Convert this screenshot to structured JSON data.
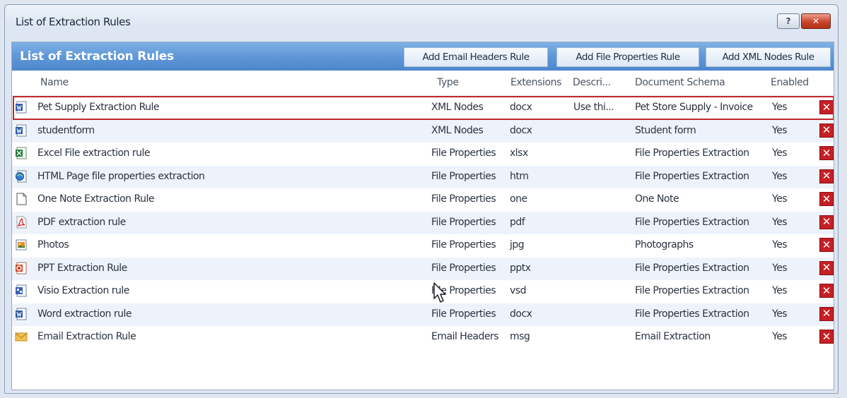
{
  "window": {
    "title": "List of Extraction Rules",
    "help_glyph": "?",
    "close_glyph": "✕"
  },
  "panel": {
    "title": "List of Extraction Rules",
    "buttons": [
      "Add Email Headers Rule",
      "Add File Properties Rule",
      "Add XML Nodes Rule"
    ]
  },
  "columns": [
    "Name",
    "Type",
    "Extensions",
    "Descri...",
    "Document Schema",
    "Enabled"
  ],
  "rows": [
    {
      "icon": "word-doc-icon",
      "name": "Pet Supply Extraction Rule",
      "type": "XML Nodes",
      "ext": "docx",
      "desc": "Use thi...",
      "schema": "Pet Store Supply - Invoice",
      "enabled": "Yes",
      "selected": true
    },
    {
      "icon": "word-doc-icon",
      "name": "studentform",
      "type": "XML Nodes",
      "ext": "docx",
      "desc": "",
      "schema": "Student form",
      "enabled": "Yes"
    },
    {
      "icon": "excel-icon",
      "name": "Excel File extraction rule",
      "type": "File Properties",
      "ext": "xlsx",
      "desc": "",
      "schema": "File Properties Extraction",
      "enabled": "Yes"
    },
    {
      "icon": "html-page-icon",
      "name": "HTML Page file properties extraction",
      "type": "File Properties",
      "ext": "htm",
      "desc": "",
      "schema": "File Properties Extraction",
      "enabled": "Yes"
    },
    {
      "icon": "blank-page-icon",
      "name": "One Note Extraction Rule",
      "type": "File Properties",
      "ext": "one",
      "desc": "",
      "schema": "One Note",
      "enabled": "Yes"
    },
    {
      "icon": "pdf-icon",
      "name": "PDF extraction rule",
      "type": "File Properties",
      "ext": "pdf",
      "desc": "",
      "schema": "File Properties Extraction",
      "enabled": "Yes"
    },
    {
      "icon": "photo-icon",
      "name": "Photos",
      "type": "File Properties",
      "ext": "jpg",
      "desc": "",
      "schema": "Photographs",
      "enabled": "Yes"
    },
    {
      "icon": "powerpoint-icon",
      "name": "PPT Extraction Rule",
      "type": "File Properties",
      "ext": "pptx",
      "desc": "",
      "schema": "File Properties Extraction",
      "enabled": "Yes"
    },
    {
      "icon": "visio-icon",
      "name": "Visio Extraction rule",
      "type": "File Properties",
      "ext": "vsd",
      "desc": "",
      "schema": "File Properties Extraction",
      "enabled": "Yes"
    },
    {
      "icon": "word-doc-icon",
      "name": "Word extraction rule",
      "type": "File Properties",
      "ext": "docx",
      "desc": "",
      "schema": "File Properties Extraction",
      "enabled": "Yes"
    },
    {
      "icon": "email-icon",
      "name": "Email Extraction Rule",
      "type": "Email Headers",
      "ext": "msg",
      "desc": "",
      "schema": "Email Extraction",
      "enabled": "Yes"
    }
  ],
  "delete_glyph": "✕",
  "colors": {
    "header_blue": "#5f97d8",
    "selection_border": "#c1272d",
    "delete_red": "#c42025",
    "alt_row": "#eef3fb"
  }
}
